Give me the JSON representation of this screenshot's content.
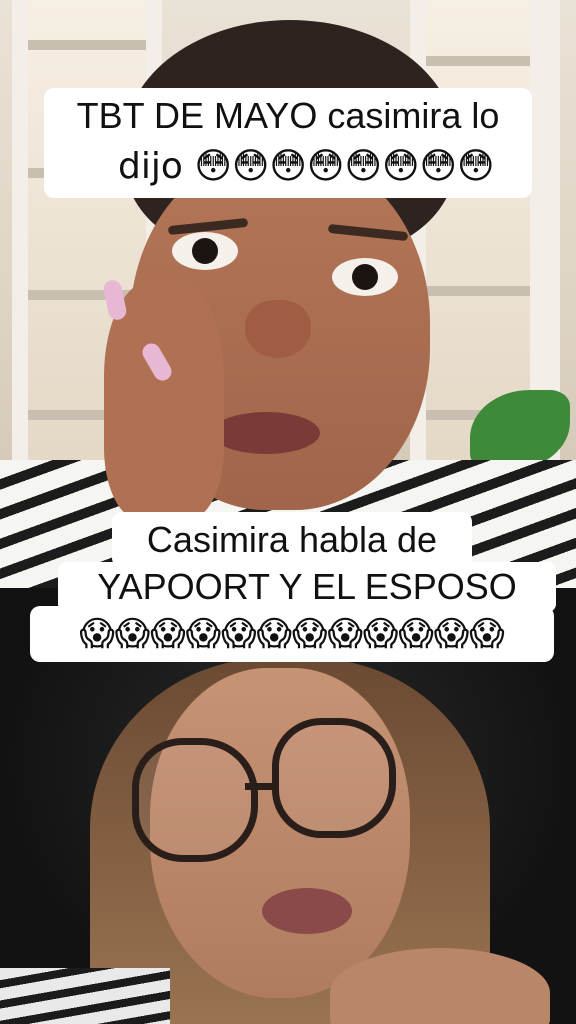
{
  "captions": {
    "top_line1": "TBT DE MAYO casimira lo",
    "top_line2": "dijo 😳😳😳😳😳😳😳😳",
    "middle_line1": "Casimira habla de",
    "middle_line2": "YAPOORT Y EL ESPOSO",
    "middle_line3": "😱😱😱😱😱😱😱😱😱😱😱😱"
  },
  "colors": {
    "caption_bg": "#ffffff",
    "caption_text": "#111111",
    "bottom_bg": "#121212"
  }
}
